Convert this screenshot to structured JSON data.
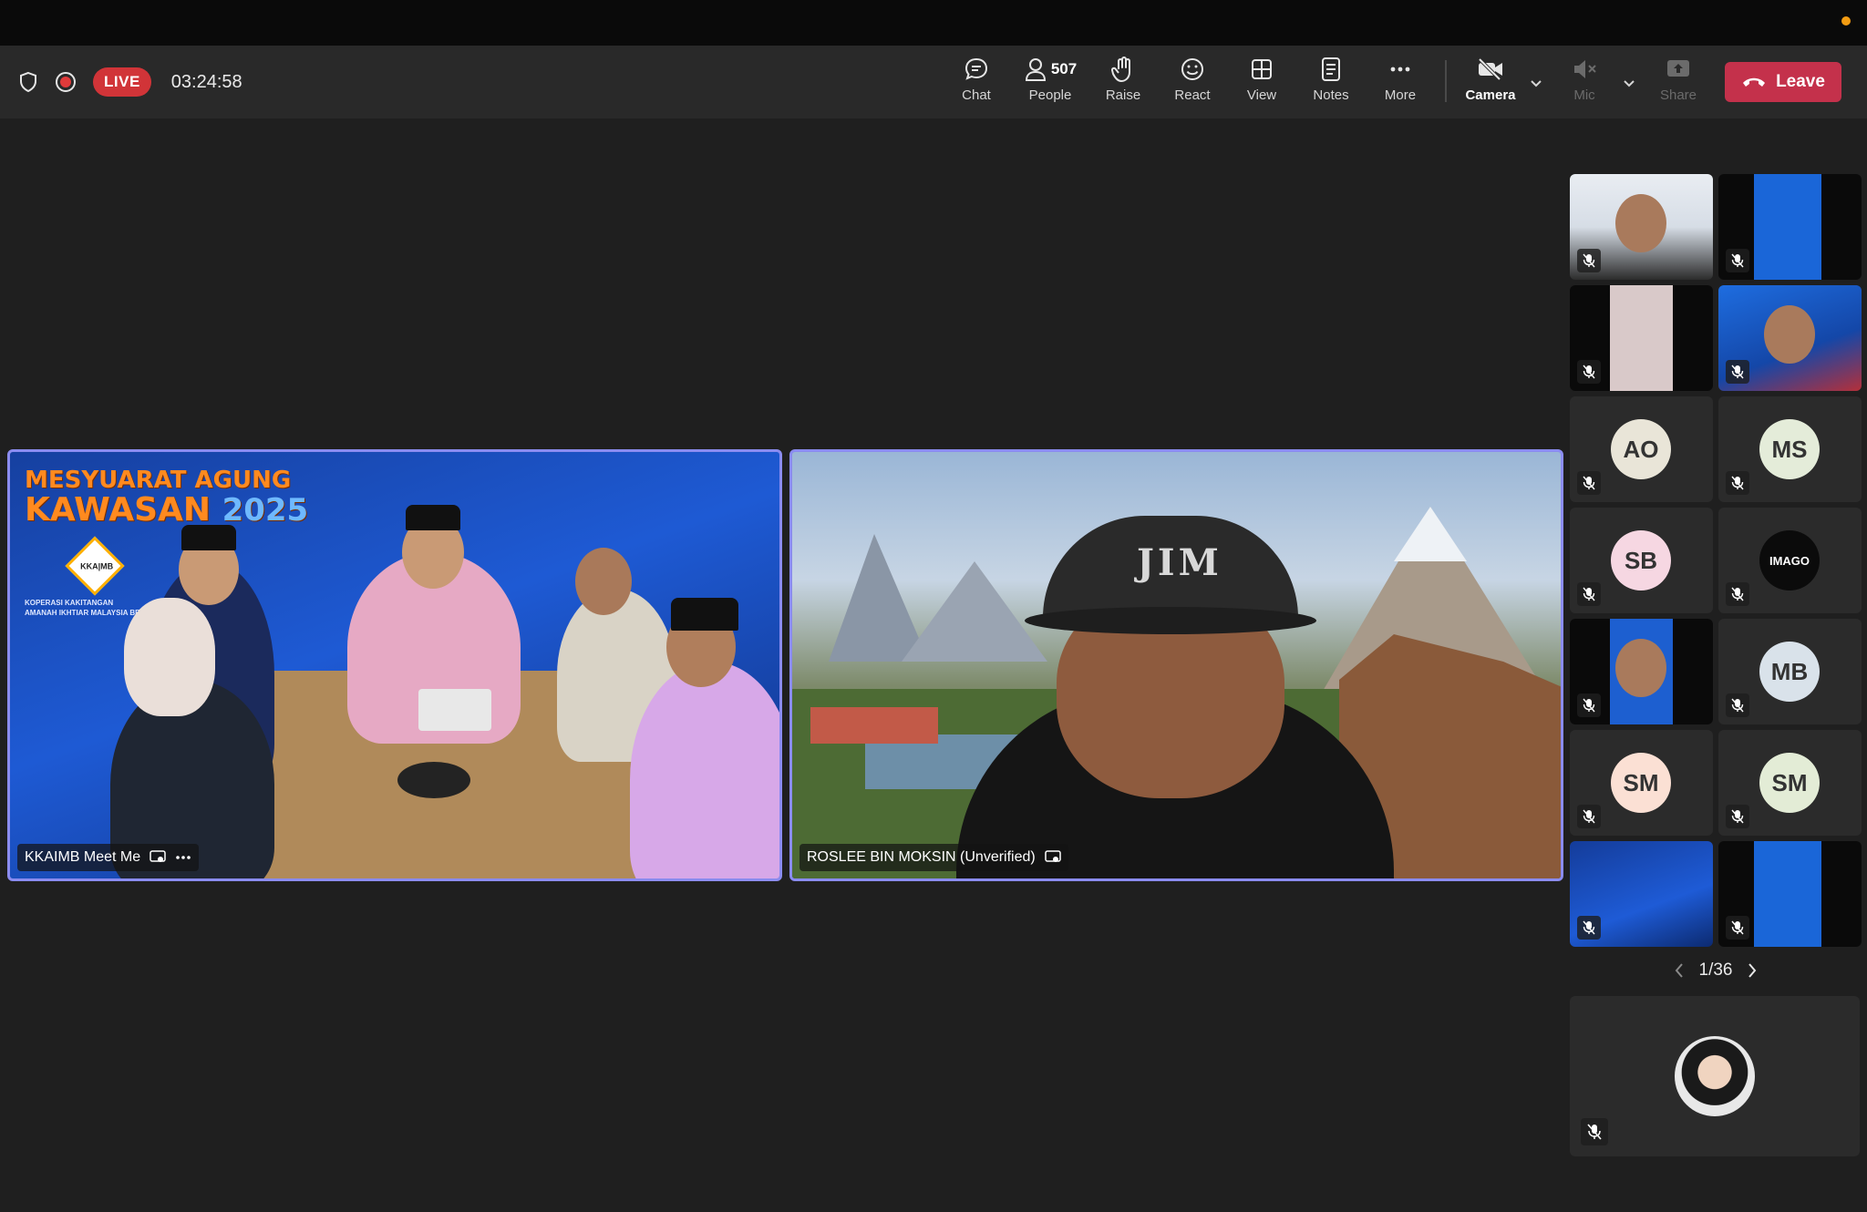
{
  "toolbar": {
    "live_label": "LIVE",
    "timer": "03:24:58",
    "chat_label": "Chat",
    "people_count": "507",
    "people_label": "People",
    "raise_label": "Raise",
    "react_label": "React",
    "view_label": "View",
    "notes_label": "Notes",
    "more_label": "More",
    "camera_label": "Camera",
    "mic_label": "Mic",
    "share_label": "Share",
    "leave_label": "Leave"
  },
  "stage": {
    "tile1": {
      "name": "KKAIMB Meet Me",
      "background_title_line1": "MESYUARAT AGUNG",
      "background_title_line2": "KAWASAN",
      "background_year": "2025",
      "logo_text": "KKA|MB",
      "org_line1": "KOPERASI KAKITANGAN",
      "org_line2": "AMANAH IKHTIAR MALAYSIA BERHAD"
    },
    "tile2": {
      "name": "ROSLEE BIN MOKSIN (Unverified)",
      "cap_text": "JIM"
    }
  },
  "sidebar": {
    "thumbnails": [
      {
        "type": "video",
        "tone": "person-office"
      },
      {
        "type": "video",
        "tone": "blue"
      },
      {
        "type": "video",
        "tone": "backdrop"
      },
      {
        "type": "video",
        "tone": "person-blue"
      },
      {
        "type": "initials",
        "initials": "AO",
        "color": "#e9e5d8"
      },
      {
        "type": "initials",
        "initials": "MS",
        "color": "#e4ecd9"
      },
      {
        "type": "initials",
        "initials": "SB",
        "color": "#f6d7e2"
      },
      {
        "type": "logo",
        "logo_text": "IMAGO"
      },
      {
        "type": "video",
        "tone": "person-blue-dark"
      },
      {
        "type": "initials",
        "initials": "MB",
        "color": "#d9e2ea"
      },
      {
        "type": "initials",
        "initials": "SM",
        "color": "#fbe0d4"
      },
      {
        "type": "initials",
        "initials": "SM",
        "color": "#e3ecd6"
      },
      {
        "type": "video",
        "tone": "banner"
      },
      {
        "type": "video",
        "tone": "blue"
      }
    ],
    "pager": "1/36"
  },
  "colors": {
    "accent_border": "#8b8cf0",
    "leave": "#c4314b",
    "live": "#d13438"
  }
}
